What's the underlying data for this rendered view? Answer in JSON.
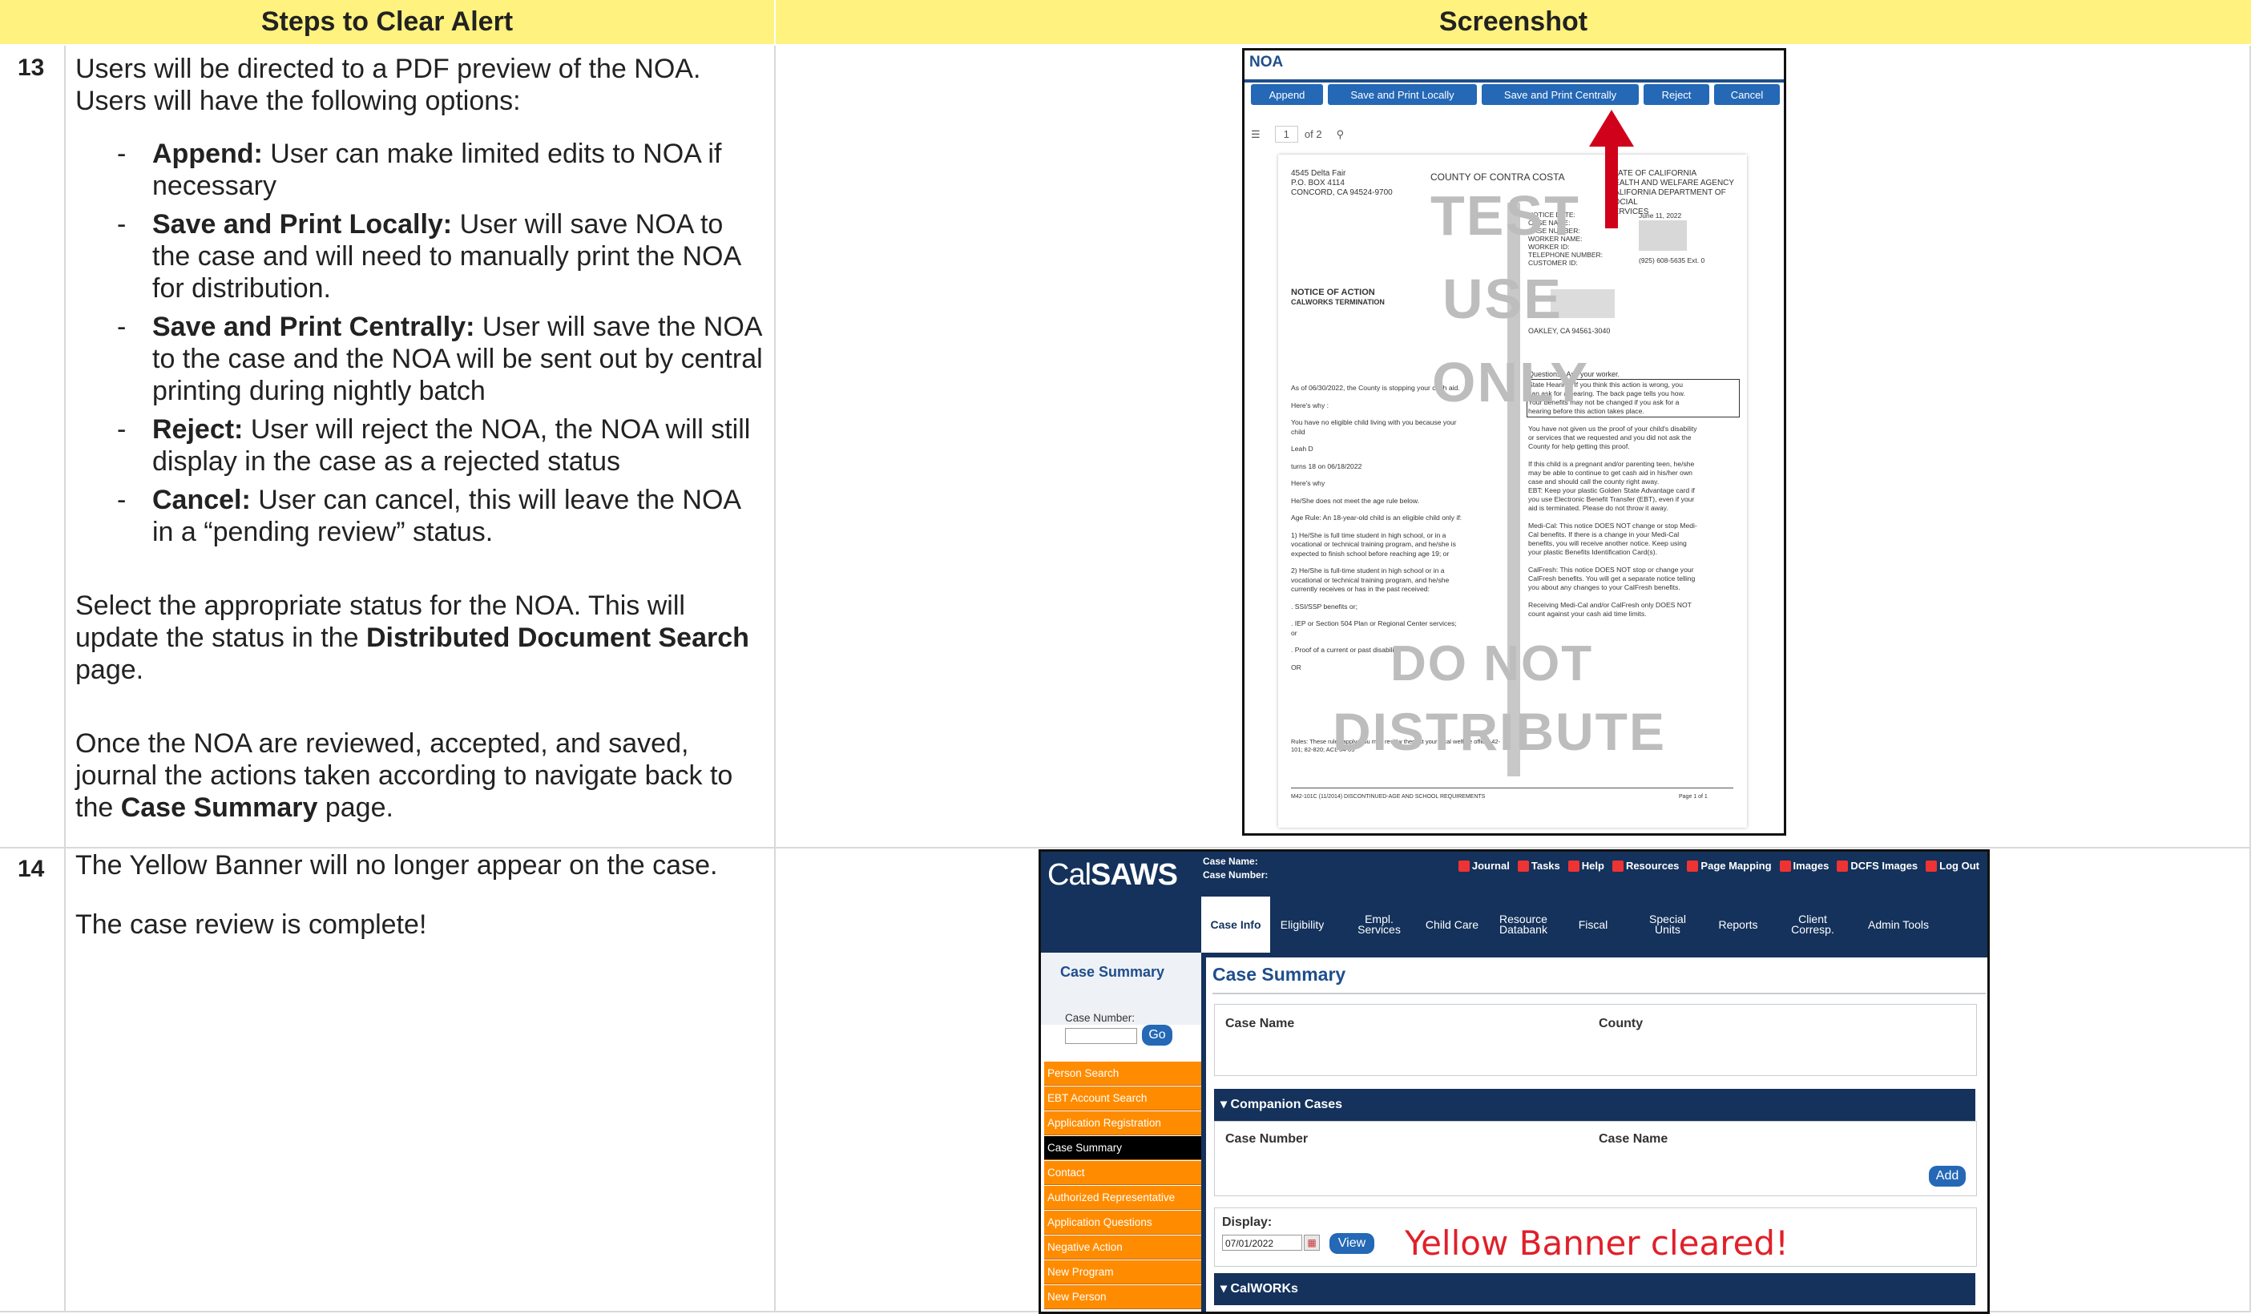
{
  "table": {
    "header_steps": "Steps to Clear Alert",
    "header_screenshot": "Screenshot"
  },
  "step13": {
    "number": "13",
    "intro": "Users will be directed to a PDF preview of the NOA. Users will have the following options:",
    "options": [
      {
        "term": "Append:",
        "text": " User can make limited edits to NOA if necessary"
      },
      {
        "term": "Save and Print Locally:",
        "text": " User will save NOA to the case and will need to manually print the NOA for distribution."
      },
      {
        "term": "Save and Print Centrally:",
        "text": " User will save the NOA to the case and the NOA will be sent out by central printing during nightly batch"
      },
      {
        "term": "Reject:",
        "text": " User will reject the NOA, the NOA will still display in the case as a rejected status"
      },
      {
        "term": "Cancel:",
        "text": " User can cancel, this will leave the NOA in a “pending review” status."
      }
    ],
    "select_pre": "Select the appropriate status for the NOA. This will update the status in the ",
    "select_bold": "Distributed Document Search",
    "select_post": " page.",
    "once_pre": "Once the NOA are reviewed, accepted, and saved, journal the actions taken according to navigate back to the ",
    "once_bold": "Case Summary",
    "once_post": " page."
  },
  "step14": {
    "number": "14",
    "line1": "The Yellow Banner will no longer appear on the case.",
    "line2": "The case review is complete!"
  },
  "noa_shot": {
    "title": "NOA",
    "buttons": [
      "Append",
      "Save and Print Locally",
      "Save and Print Centrally",
      "Reject",
      "Cancel"
    ],
    "page_input": "1",
    "page_of": "of 2",
    "addr": [
      "4545 Delta Fair",
      "P.O. BOX 4114",
      "CONCORD, CA 94524-9700"
    ],
    "county": "COUNTY OF CONTRA COSTA",
    "state": [
      "STATE OF CALIFORNIA",
      "HEALTH AND WELFARE AGENCY",
      "CALIFORNIA DEPARTMENT OF SOCIAL",
      "SERVICES"
    ],
    "notice_fields": [
      "NOTICE DATE:",
      "CASE NAME:",
      "CASE NUMBER:",
      "WORKER NAME:",
      "WORKER ID:",
      "TELEPHONE NUMBER:",
      "CUSTOMER ID:"
    ],
    "notice_date": "June 11, 2022",
    "phone": "(925) 608-5635 Ext. 0",
    "notice_title": "NOTICE OF ACTION",
    "notice_sub": "CALWORKS TERMINATION",
    "city": "OAKLEY, CA 94561-3040",
    "questions": "Questions? Ask your worker.",
    "left_body": [
      "As of 06/30/2022, the County is stopping your cash aid.",
      "Here's why :",
      "You have no eligible child living with you because your",
      "child",
      "Leah D",
      "turns 18 on 06/18/2022",
      "Here's why",
      "He/She does not meet the age rule below.",
      "Age Rule: An 18-year-old child is an eligible child only if:",
      "1) He/She is full time student in high school, or in a",
      "vocational or technical training program, and he/she is",
      "expected to finish school before reaching age 19; or",
      "2) He/She is full-time student in high school or in a",
      "vocational or technical training program, and he/she",
      "currently receives or has in the past received:",
      ". SSI/SSP benefits or;",
      ". IEP or Section 504 Plan or Regional Center services;",
      "or",
      ". Proof of a current or past disability.",
      "OR"
    ],
    "rules": "Rules: These rules apply; you may review them at your local welfare office: 42-101; 82-820; ACL 04-05",
    "right_body": [
      "State Hearing: If you think this action is wrong, you",
      "can ask for a hearing. The back page tells you how.",
      "Your benefits may not be changed if you ask for a",
      "hearing before this action takes place.",
      "",
      "You have not given us the proof of your child's disability",
      "or services that we requested and you did not ask the",
      "County for help getting this proof.",
      "",
      "If this child is a pregnant and/or parenting teen, he/she",
      "may be able to continue to get cash aid in his/her own",
      "case and should call the county right away.",
      "EBT: Keep your plastic Golden State Advantage card if",
      "you use Electronic Benefit Transfer (EBT), even if your",
      "aid is terminated.  Please do not throw it away.",
      "",
      "Medi-Cal: This notice DOES NOT change or stop Medi-",
      "Cal benefits.  If there is a change in your Medi-Cal",
      "benefits, you will receive another notice.  Keep using",
      "your plastic Benefits Identification Card(s).",
      "",
      "CalFresh: This notice DOES NOT stop or change your",
      "CalFresh benefits.  You will get a separate notice telling",
      "you about any changes to your CalFresh benefits.",
      "",
      "Receiving Medi-Cal and/or CalFresh only DOES NOT",
      "count against your cash aid time limits."
    ],
    "footer_left": "M42-101C (11/2014) DISCONTINUED-AGE AND SCHOOL REQUIREMENTS",
    "footer_right": "Page 1 of 1",
    "watermark": [
      "TEST",
      "USE",
      "ONLY",
      "DO NOT",
      "DISTRIBUTE"
    ]
  },
  "calsaws": {
    "logo_a": "Cal",
    "logo_b": "SAWS",
    "case_name_label": "Case Name:",
    "case_number_label": "Case Number:",
    "top_links": [
      "Journal",
      "Tasks",
      "Help",
      "Resources",
      "Page Mapping",
      "Images",
      "DCFS Images",
      "Log Out"
    ],
    "tabs": [
      "Case Info",
      "Eligibility",
      "Empl.\nServices",
      "Child Care",
      "Resource\nDatabank",
      "Fiscal",
      "Special\nUnits",
      "Reports",
      "Client\nCorresp.",
      "Admin Tools"
    ],
    "side_title": "Case Summary",
    "side_case_label": "Case Number:",
    "go": "Go",
    "side_items": [
      "Person Search",
      "EBT Account Search",
      "Application Registration",
      "Case Summary",
      "Contact",
      "Authorized Representative",
      "Application Questions",
      "Negative Action",
      "New Program",
      "New Person"
    ],
    "page_title": "Case Summary",
    "case_name_col": "Case Name",
    "county_col": "County",
    "companion": "Companion Cases",
    "cc_number": "Case Number",
    "cc_name": "Case Name",
    "add": "Add",
    "display_label": "Display:",
    "display_date": "07/01/2022",
    "view": "View",
    "calworks": "CalWORKs",
    "callout": "Yellow Banner cleared!"
  },
  "colors": {
    "header_yellow": "#fff27f",
    "calsaws_navy": "#14325b",
    "button_blue": "#2468b6",
    "side_orange": "#ff8c00",
    "arrow_red": "#d0021b",
    "callout_red": "#e0202a"
  }
}
